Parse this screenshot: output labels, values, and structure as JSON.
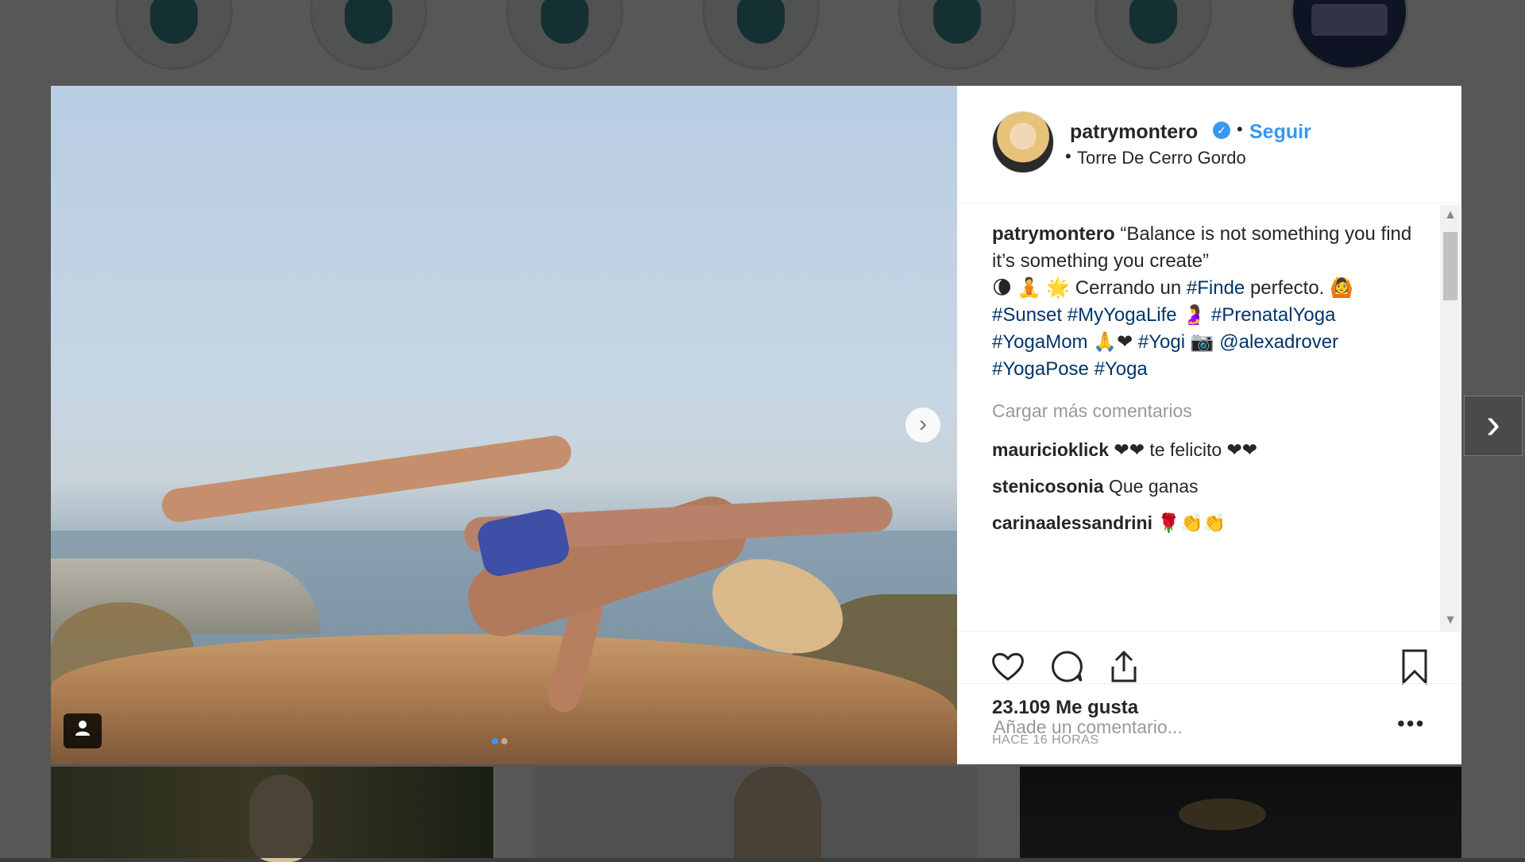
{
  "post": {
    "username": "patrymontero",
    "follow_label": "Seguir",
    "separator": "•",
    "location": "Torre De Cerro Gordo",
    "caption": {
      "author": "patrymontero",
      "quote": "“Balance is not something you find it’s something you create”",
      "text1": "Cerrando un",
      "tag_finde": "#Finde",
      "text2": "perfecto.",
      "tag_sunset": "#Sunset",
      "tag_myyogalife": "#MyYogaLife",
      "tag_prenatal": "#PrenatalYoga",
      "tag_yogamom": "#YogaMom",
      "tag_yogi": "#Yogi",
      "mention": "@alexadrover",
      "tag_yogapose": "#YogaPose",
      "tag_yoga": "#Yoga"
    },
    "load_more": "Cargar más comentarios",
    "comments": [
      {
        "user": "mauricioklick",
        "text": "❤❤ te felicito ❤❤"
      },
      {
        "user": "stenicosonia",
        "text": "Que ganas"
      },
      {
        "user": "carinaalessandrini",
        "text": "🌹👏👏"
      }
    ],
    "likes": "23.109 Me gusta",
    "time": "HACE 16 HORAS",
    "comment_placeholder": "Añade un comentario...",
    "more_options": "•••"
  },
  "icons": {
    "like": "heart-icon",
    "comment": "comment-icon",
    "share": "share-icon",
    "save": "bookmark-icon",
    "next": "chevron-right-icon",
    "tag": "user-tag-icon"
  },
  "colors": {
    "link": "#3897f0",
    "hashtag": "#003569",
    "text": "#262626",
    "muted": "#999999"
  }
}
